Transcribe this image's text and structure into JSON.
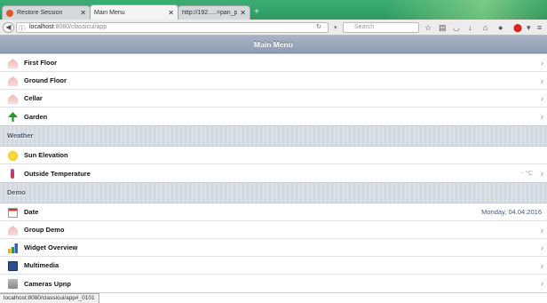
{
  "browser": {
    "tabs": [
      {
        "label": "Restore Session",
        "active": false
      },
      {
        "label": "Main Menu",
        "active": true
      },
      {
        "label": "http://192.....=pan_patrol",
        "active": false
      }
    ],
    "url": {
      "host": "localhost",
      "rest": ":8080/classicui/app"
    },
    "search_placeholder": "Search",
    "status_url": "localhost:8080/classicui/app#_0101"
  },
  "header": {
    "title": "Main Menu"
  },
  "groups": [
    {
      "title": "",
      "items": [
        {
          "label": "First Floor",
          "icon": "house-icon",
          "value": ""
        },
        {
          "label": "Ground Floor",
          "icon": "house-icon",
          "value": ""
        },
        {
          "label": "Cellar",
          "icon": "house-icon",
          "value": ""
        },
        {
          "label": "Garden",
          "icon": "tree-icon",
          "value": ""
        }
      ]
    },
    {
      "title": "Weather",
      "items": [
        {
          "label": "Sun Elevation",
          "icon": "sun-icon",
          "value": ""
        },
        {
          "label": "Outside Temperature",
          "icon": "thermometer-icon",
          "value": "- °C"
        }
      ]
    },
    {
      "title": "Demo",
      "items": [
        {
          "label": "Date",
          "icon": "calendar-icon",
          "value": "Monday, 04.04.2016"
        },
        {
          "label": "Group Demo",
          "icon": "house-icon",
          "value": ""
        },
        {
          "label": "Widget Overview",
          "icon": "bar-chart-icon",
          "value": ""
        },
        {
          "label": "Multimedia",
          "icon": "media-player-icon",
          "value": ""
        },
        {
          "label": "Cameras Upnp",
          "icon": "camera-icon",
          "value": ""
        }
      ]
    }
  ],
  "colors": {
    "header": "#8e9db3",
    "value_text": "#3e5a86",
    "tabbar": "#2d9963"
  }
}
